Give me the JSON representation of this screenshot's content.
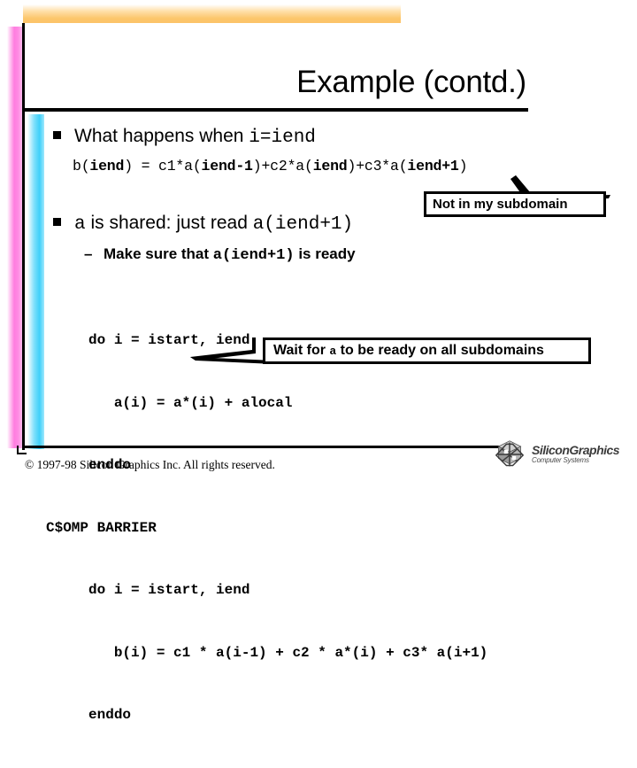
{
  "slide": {
    "title": "Example (contd.)",
    "bullets": [
      {
        "marker": "square",
        "text_plain": "What happens when ",
        "text_mono": "i=iend"
      },
      {
        "marker": "square",
        "mono_lead": "a",
        "text_plain": " is shared:  just read ",
        "text_mono": "a(iend+1)"
      }
    ],
    "sub_bullet": {
      "marker": "–",
      "text_before": "Make sure that ",
      "text_mono": "a(iend+1)",
      "text_after": " is ready"
    },
    "equation": {
      "full": "b(iend) = c1*a(iend-1)+c2*a(iend)+c3*a(iend+1)",
      "parts": [
        {
          "t": "b(",
          "bold": false
        },
        {
          "t": "iend",
          "bold": true
        },
        {
          "t": ") = c1*a(",
          "bold": false
        },
        {
          "t": "iend-1",
          "bold": true
        },
        {
          "t": ")+c2*a(",
          "bold": false
        },
        {
          "t": "iend",
          "bold": true
        },
        {
          "t": ")+c3*a(",
          "bold": false
        },
        {
          "t": "iend+1",
          "bold": true
        },
        {
          "t": ")",
          "bold": false
        }
      ]
    },
    "code_lines": [
      "     do i = istart, iend",
      "        a(i) = a*(i) + alocal",
      "     enddo",
      "C$OMP BARRIER",
      "     do i = istart, iend",
      "        b(i) = c1 * a(i-1) + c2 * a*(i) + c3* a(i+1)",
      "     enddo"
    ],
    "callouts": [
      {
        "id": "not-in-my-subdomain",
        "text": "Not in my subdomain"
      },
      {
        "id": "wait-for-a",
        "text_before": "Wait for ",
        "text_mono": "a",
        "text_after": " to be ready on all subdomains"
      }
    ]
  },
  "footer": {
    "copyright": "© 1997-98 Silicon Graphics Inc. All rights reserved.",
    "logo_name": "SiliconGraphics",
    "logo_sub": "Computer Systems"
  },
  "colors": {
    "accent_orange": "#fcc469",
    "accent_pink": "#ff7de0",
    "accent_cyan": "#3fd0fa",
    "rule": "#000000",
    "background": "#ffffff"
  }
}
